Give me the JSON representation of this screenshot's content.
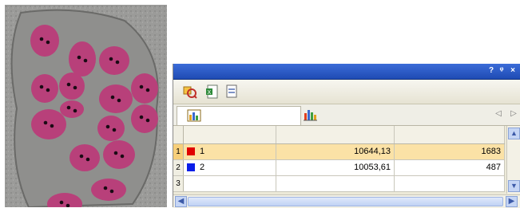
{
  "window": {
    "help_glyph": "?",
    "pin_glyph": "ᵠ",
    "close_glyph": "×"
  },
  "colors": {
    "titlebar": "#2a57c4",
    "selected_row": "#fbe2a6",
    "series_1": "#e00000",
    "series_2": "#0a1ee8",
    "cell_stain": "#b8407a"
  },
  "toolbar": {
    "icons": [
      "select-objects-icon",
      "export-excel-icon",
      "copy-icon"
    ]
  },
  "tabs": [
    {
      "icon": "table-chart-icon",
      "active": true
    },
    {
      "icon": "bar-chart-icon",
      "active": false
    }
  ],
  "nav": {
    "left": "◁",
    "right": "▷"
  },
  "table": {
    "rows": [
      {
        "index": "1",
        "label": "1",
        "value_a": "10644,13",
        "value_b": "1683",
        "color": "#e00000",
        "selected": true
      },
      {
        "index": "2",
        "label": "2",
        "value_a": "10053,61",
        "value_b": "487",
        "color": "#0a1ee8",
        "selected": false
      },
      {
        "index": "3",
        "label": "",
        "value_a": "",
        "value_b": "",
        "color": "",
        "selected": false
      }
    ]
  },
  "scroll": {
    "up": "▲",
    "down": "▼",
    "left": "◀",
    "right": "▶"
  }
}
